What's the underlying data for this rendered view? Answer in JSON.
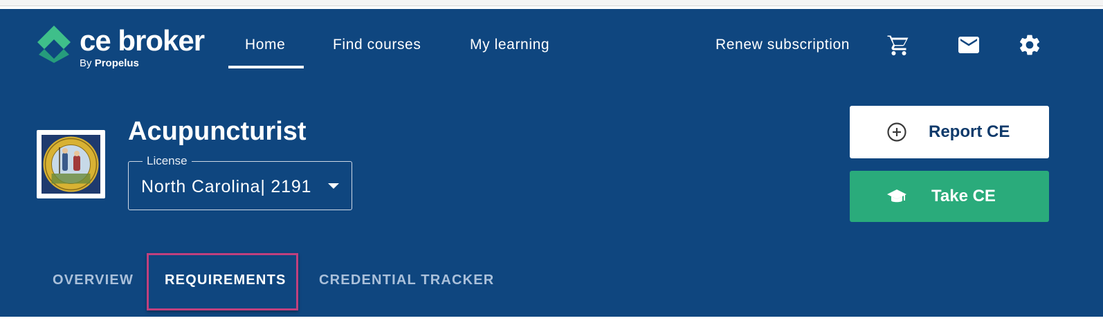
{
  "brand": {
    "name": "ce broker",
    "by": "By",
    "company": "Propelus",
    "colors": {
      "primary": "#0f467f",
      "accent_green": "#2aab7b",
      "logo_green": "#3fbf8a",
      "highlight": "#c0407e"
    }
  },
  "nav": {
    "items": [
      {
        "label": "Home",
        "active": true
      },
      {
        "label": "Find courses",
        "active": false
      },
      {
        "label": "My learning",
        "active": false
      }
    ],
    "renew": "Renew subscription",
    "icons": [
      "cart-icon",
      "mail-icon",
      "gear-icon"
    ]
  },
  "license": {
    "title": "Acupuncturist",
    "legend": "License",
    "value": "North Carolina| 2191",
    "seal_icon": "state-seal-icon"
  },
  "actions": {
    "report": {
      "label": "Report CE",
      "icon": "plus-circle-icon"
    },
    "take": {
      "label": "Take CE",
      "icon": "graduation-cap-icon"
    }
  },
  "tabs": [
    {
      "label": "OVERVIEW",
      "active": false
    },
    {
      "label": "REQUIREMENTS",
      "active": true
    },
    {
      "label": "CREDENTIAL TRACKER",
      "active": false
    }
  ]
}
